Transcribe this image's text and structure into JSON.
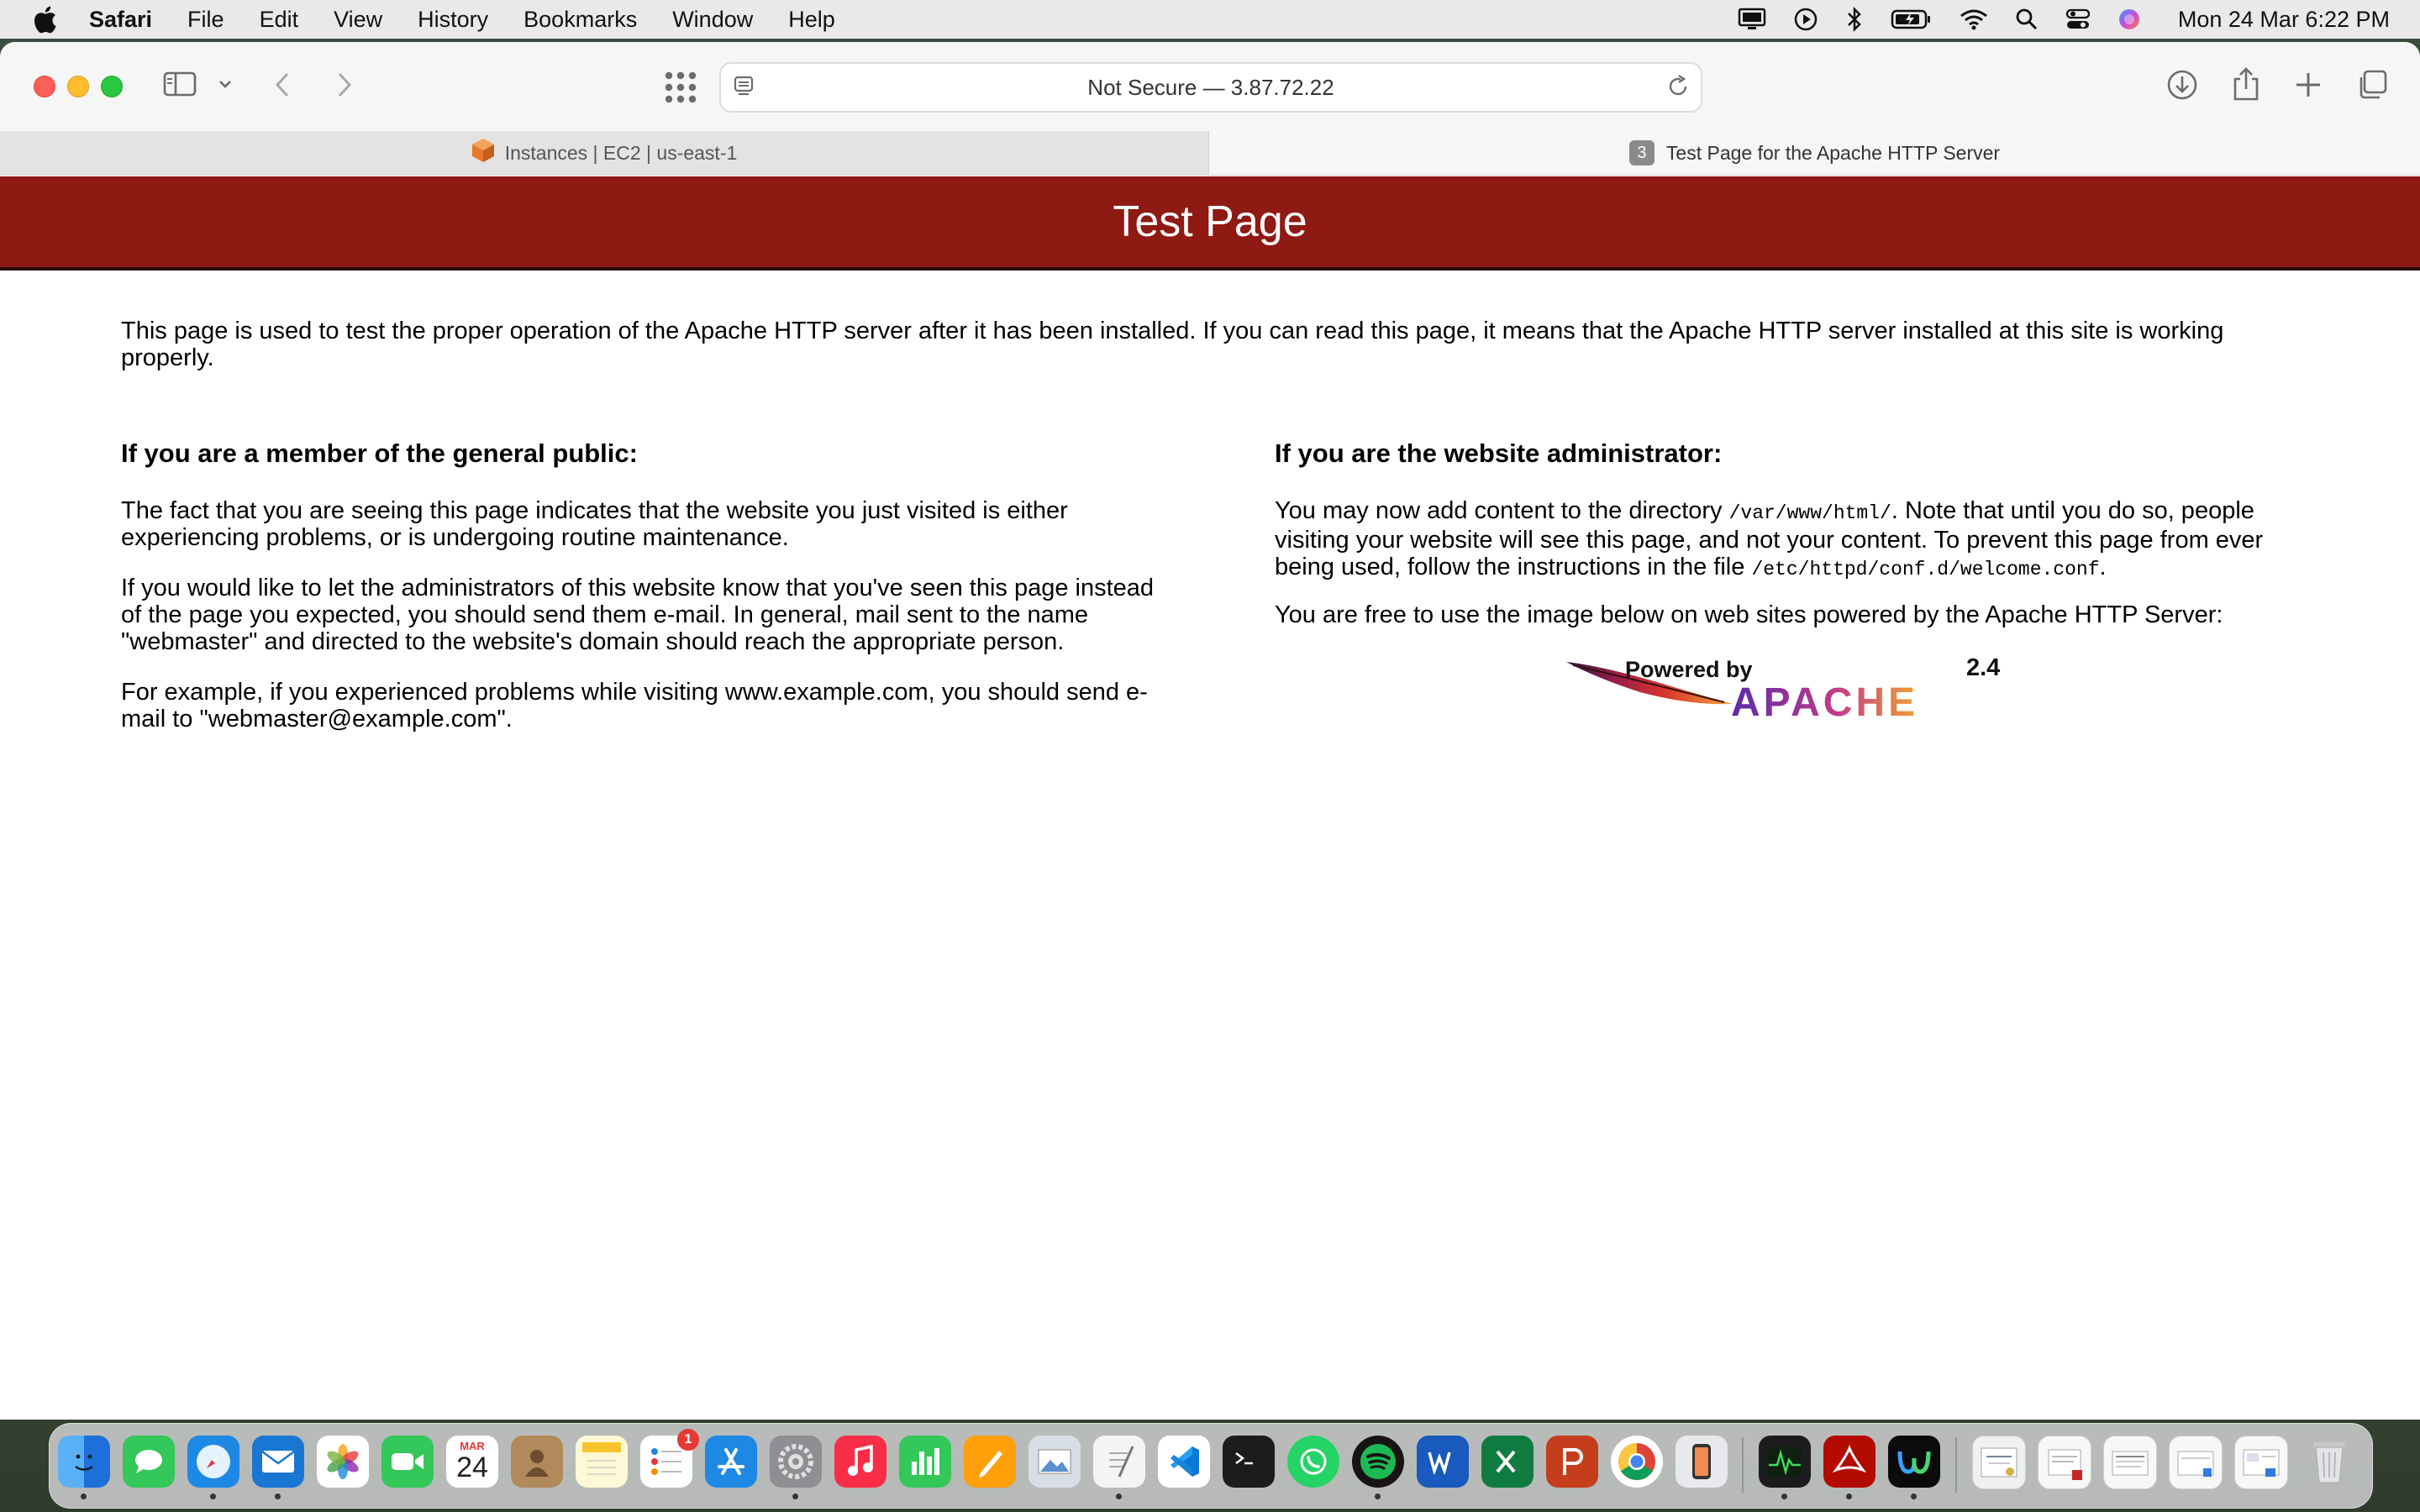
{
  "menubar": {
    "app_name": "Safari",
    "items": [
      "File",
      "Edit",
      "View",
      "History",
      "Bookmarks",
      "Window",
      "Help"
    ],
    "clock": "Mon 24 Mar  6:22 PM"
  },
  "toolbar": {
    "address": "Not Secure — 3.87.72.22"
  },
  "tabs": [
    {
      "label": "Instances | EC2 | us-east-1",
      "active": false
    },
    {
      "label": "Test Page for the Apache HTTP Server",
      "badge": "3",
      "active": true
    }
  ],
  "page": {
    "banner_title": "Test Page",
    "intro": "This page is used to test the proper operation of the Apache HTTP server after it has been installed. If you can read this page, it means that the Apache HTTP server installed at this site is working properly.",
    "public": {
      "heading": "If you are a member of the general public:",
      "p1": "The fact that you are seeing this page indicates that the website you just visited is either experiencing problems, or is undergoing routine maintenance.",
      "p2": "If you would like to let the administrators of this website know that you've seen this page instead of the page you expected, you should send them e-mail. In general, mail sent to the name \"webmaster\" and directed to the website's domain should reach the appropriate person.",
      "p3": "For example, if you experienced problems while visiting www.example.com, you should send e-mail to \"webmaster@example.com\"."
    },
    "admin": {
      "heading": "If you are the website administrator:",
      "p1_a": "You may now add content to the directory ",
      "p1_code1": "/var/www/html/",
      "p1_b": ". Note that until you do so, people visiting your website will see this page, and not your content. To prevent this page from ever being used, follow the instructions in the file ",
      "p1_code2": "/etc/httpd/conf.d/welcome.conf",
      "p1_c": ".",
      "p2": "You are free to use the image below on web sites powered by the Apache HTTP Server:"
    },
    "logo": {
      "line1": "Powered by",
      "version": "2.4",
      "word": "APACHE"
    }
  },
  "dock": {
    "calendar_month": "MAR",
    "calendar_day": "24",
    "reminders_badge": "1"
  },
  "colors": {
    "banner": "#8f1913",
    "menubar": "#e9e9eb"
  }
}
